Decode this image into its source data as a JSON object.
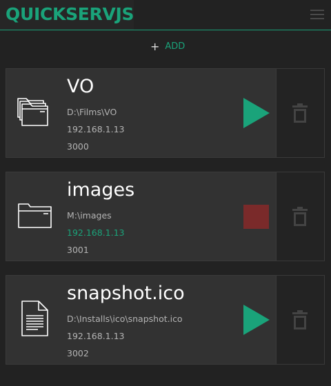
{
  "header": {
    "title": "QUICKSERVJS",
    "menu_icon": "hamburger-menu-icon",
    "accent_color": "#1aa37a"
  },
  "toolbar": {
    "add_icon": "+",
    "add_label": "ADD"
  },
  "servers": [
    {
      "name": "VO",
      "path": "D:\\Films\\VO",
      "ip": "192.168.1.13",
      "port": "3000",
      "icon": "multiple-folders-icon",
      "status": "stopped",
      "action_icon": "play-icon"
    },
    {
      "name": "images",
      "path": "M:\\images",
      "ip": "192.168.1.13",
      "port": "3001",
      "icon": "folder-icon",
      "status": "running",
      "action_icon": "stop-icon"
    },
    {
      "name": "snapshot.ico",
      "path": "D:\\Installs\\ico\\snapshot.ico",
      "ip": "192.168.1.13",
      "port": "3002",
      "icon": "file-icon",
      "status": "stopped",
      "action_icon": "play-icon"
    }
  ],
  "colors": {
    "play": "#1aa37a",
    "stop": "#7a2a2a",
    "delete_icon": "#444444"
  }
}
